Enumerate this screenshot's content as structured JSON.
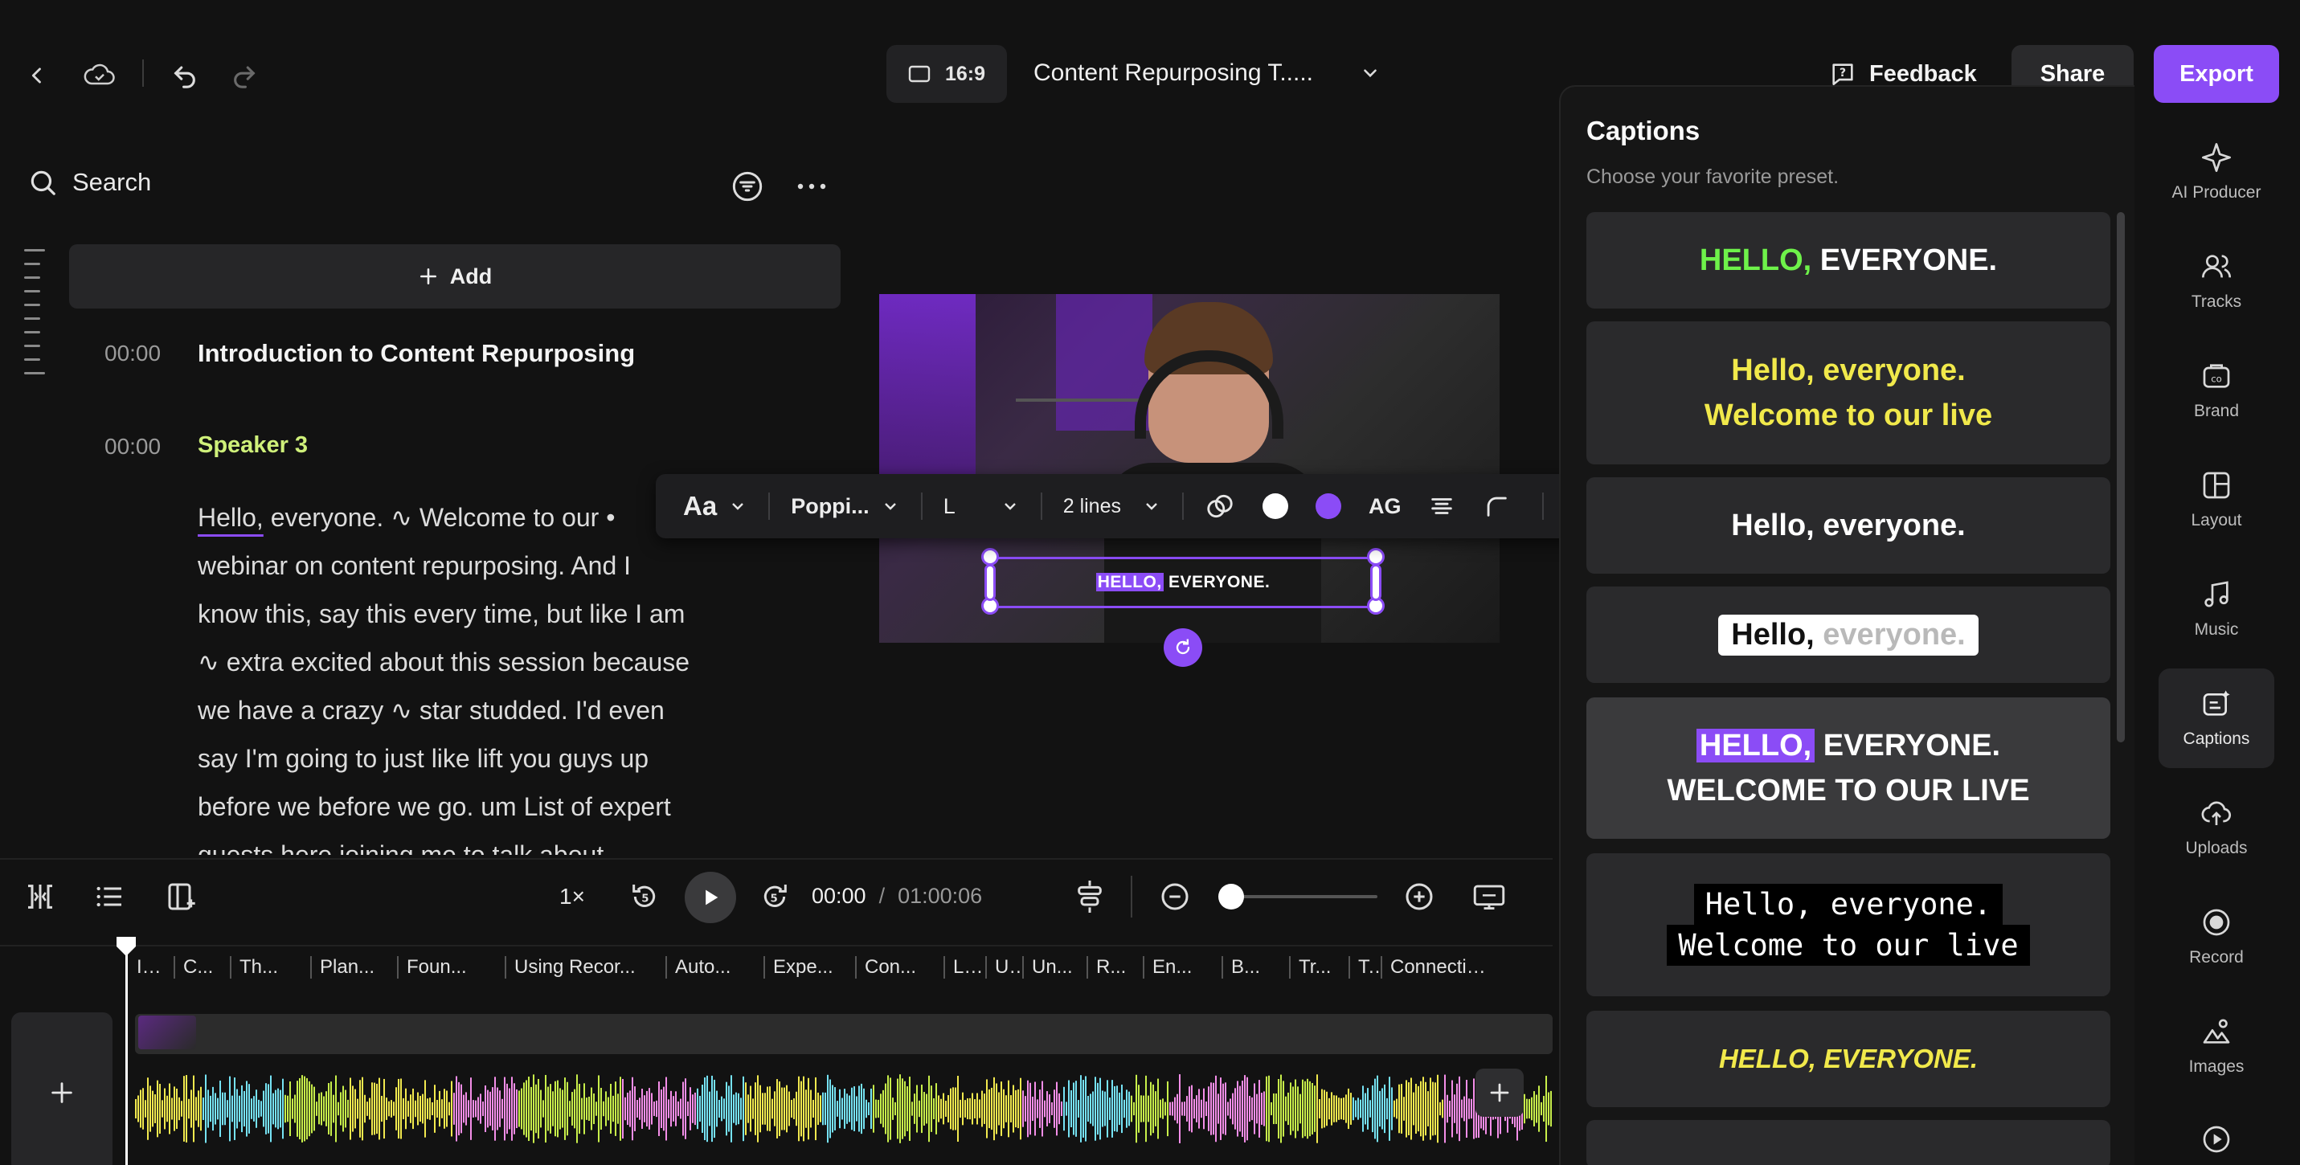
{
  "topbar": {
    "aspect_ratio": "16:9",
    "project_title": "Content Repurposing T.....",
    "feedback_label": "Feedback",
    "share_label": "Share",
    "export_label": "Export"
  },
  "script": {
    "search_label": "Search",
    "add_label": "Add",
    "chapter": {
      "time": "00:00",
      "title": "Introduction to Content Repurposing"
    },
    "speaker": {
      "time": "00:00",
      "name": "Speaker 3"
    },
    "transcript_lines": [
      {
        "highlight": "Hello,",
        "text": " everyone. ∿ Welcome to our •"
      },
      {
        "highlight": "",
        "text": "webinar on content repurposing. And I"
      },
      {
        "highlight": "",
        "text": "know this, say this every time, but like I am"
      },
      {
        "highlight": "",
        "text": "∿ extra excited about this session because"
      },
      {
        "highlight": "",
        "text": "we have a crazy ∿ star studded. I'd even"
      },
      {
        "highlight": "",
        "text": "say I'm going to just like lift you guys up"
      },
      {
        "highlight": "",
        "text": "before we before we go. um List of expert"
      },
      {
        "highlight": "",
        "text": "guests here joining me to talk about"
      }
    ]
  },
  "preview": {
    "caption_highlight": "HELLO,",
    "caption_rest": " EVERYONE."
  },
  "caption_toolbar": {
    "case_label": "Aa",
    "font_label": "Poppi...",
    "size_label": "L",
    "lines_label": "2 lines",
    "effect_label": "AG",
    "color_1": "#ffffff",
    "color_2": "#8b4cf6"
  },
  "captions_panel": {
    "title": "Captions",
    "subtitle": "Choose your favorite preset.",
    "presets": [
      {
        "a": "HELLO,",
        "b": " EVERYONE."
      },
      {
        "a": "Hello, everyone.",
        "b": "Welcome to our live"
      },
      {
        "a": "Hello, everyone."
      },
      {
        "a": "Hello,",
        "b": " everyone."
      },
      {
        "a": "HELLO,",
        "b": " EVERYONE.",
        "c": "WELCOME TO OUR LIVE"
      },
      {
        "a": "Hello, everyone.",
        "b": "Welcome to our live"
      },
      {
        "a": "HELLO, EVERYONE."
      }
    ]
  },
  "sidebar_nav": [
    {
      "label": "AI Producer",
      "icon": "sparkle-icon"
    },
    {
      "label": "Tracks",
      "icon": "people-icon"
    },
    {
      "label": "Brand",
      "icon": "brand-icon"
    },
    {
      "label": "Layout",
      "icon": "layout-icon"
    },
    {
      "label": "Music",
      "icon": "music-icon"
    },
    {
      "label": "Captions",
      "icon": "captions-icon",
      "active": true
    },
    {
      "label": "Uploads",
      "icon": "upload-icon"
    },
    {
      "label": "Record",
      "icon": "record-icon"
    },
    {
      "label": "Images",
      "icon": "images-icon"
    }
  ],
  "transport": {
    "speed": "1×",
    "current_time": "00:00",
    "separator": "/",
    "duration": "01:00:06",
    "zoom_fraction": 0.05
  },
  "timeline": {
    "chapters": [
      "In...",
      "C...",
      "Th...",
      "Plan...",
      "Foun...",
      "Using Recor...",
      "Auto...",
      "Expe...",
      "Con...",
      "L...",
      "U..",
      "Un...",
      "R...",
      "En...",
      "B...",
      "Tr...",
      "T..",
      "Connectin..."
    ],
    "waveform_colors": [
      "#f2e94e",
      "#f48ee8",
      "#76e3f5",
      "#c8ef4a"
    ]
  }
}
